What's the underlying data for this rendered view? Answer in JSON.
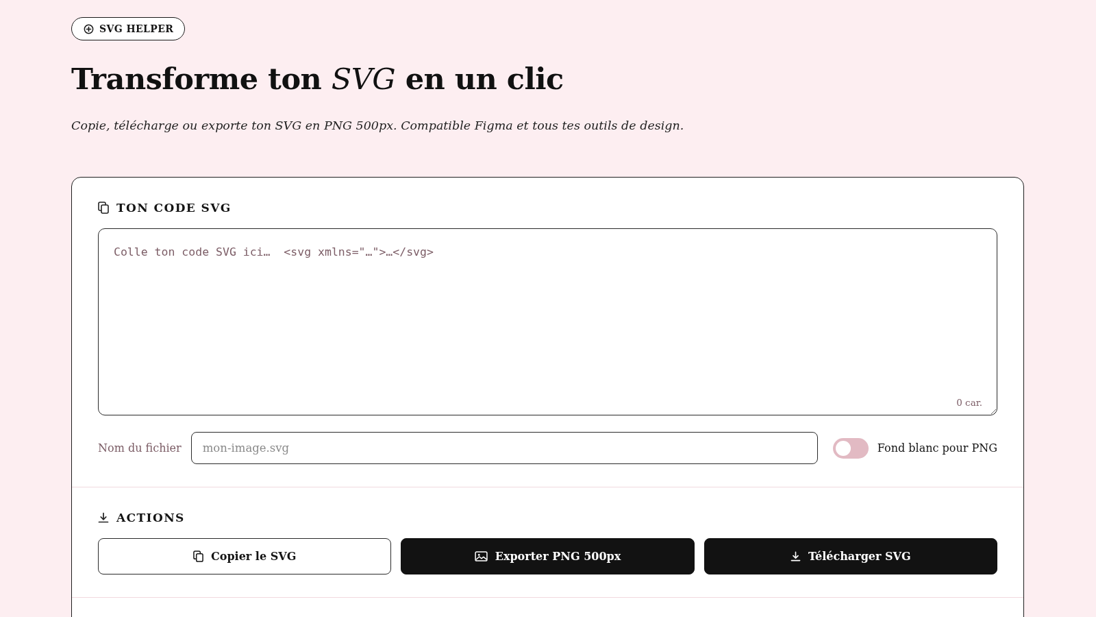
{
  "badge": {
    "label": "SVG HELPER"
  },
  "title": "Transforme ton *SVG* en un clic",
  "subtitle": "Copie, télécharge ou exporte ton SVG en PNG 500px. Compatible Figma et tous tes outils de design.",
  "svg_section": {
    "heading": "TON CODE SVG",
    "code_field": {
      "placeholder": "Colle ton code SVG ici…  <svg xmlns=\"…\">…</svg>"
    },
    "char_count": "0 car."
  },
  "filename": {
    "label": "Nom du fichier",
    "placeholder": "mon-image.svg"
  },
  "white_background_toggle": {
    "label": "Fond blanc pour PNG",
    "on": false
  },
  "actions": {
    "heading": "ACTIONS",
    "buttons": [
      {
        "label": "Copier le SVG",
        "kind": "copy",
        "primary": false
      },
      {
        "label": "Exporter PNG 500px",
        "kind": "image",
        "primary": true
      },
      {
        "label": "Télécharger SVG",
        "kind": "download",
        "primary": true
      }
    ]
  }
}
